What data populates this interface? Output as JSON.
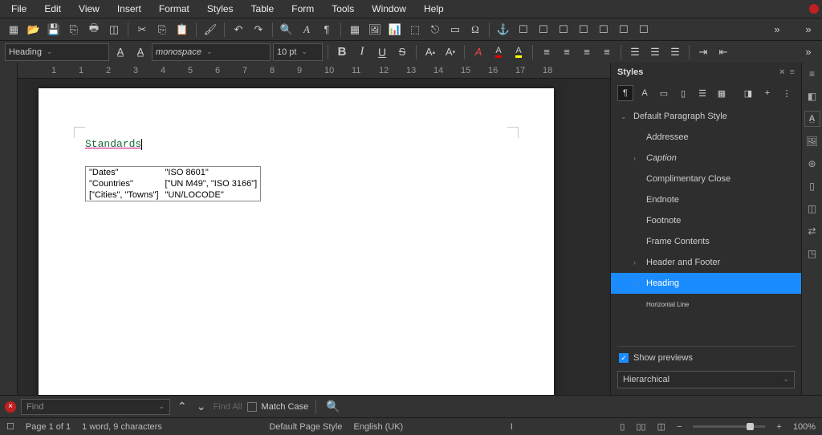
{
  "menubar": [
    "File",
    "Edit",
    "View",
    "Insert",
    "Format",
    "Styles",
    "Table",
    "Form",
    "Tools",
    "Window",
    "Help"
  ],
  "toolbar2": {
    "paragraph_style": "Heading",
    "font_name": "monospace",
    "font_size": "10 pt"
  },
  "document": {
    "heading": "Standards",
    "table": [
      [
        "\"Dates\"",
        "\"ISO 8601\""
      ],
      [
        "\"Countries\"",
        "[\"UN M49\", \"ISO 3166\"]"
      ],
      [
        "[\"Cities\", \"Towns\"]",
        "\"UN/LOCODE\""
      ]
    ]
  },
  "styles_panel": {
    "title": "Styles",
    "items": [
      {
        "label": "Default Paragraph Style",
        "depth": 0,
        "exp": "v"
      },
      {
        "label": "Addressee",
        "depth": 1,
        "exp": ""
      },
      {
        "label": "Caption",
        "depth": 1,
        "exp": ">",
        "italic": true
      },
      {
        "label": "Complimentary Close",
        "depth": 1,
        "exp": ""
      },
      {
        "label": "Endnote",
        "depth": 1,
        "exp": ""
      },
      {
        "label": "Footnote",
        "depth": 1,
        "exp": ""
      },
      {
        "label": "Frame Contents",
        "depth": 1,
        "exp": ""
      },
      {
        "label": "Header and Footer",
        "depth": 1,
        "exp": ">"
      },
      {
        "label": "Heading",
        "depth": 1,
        "exp": ">",
        "sel": true
      },
      {
        "label": "Horizontal Line",
        "depth": 1,
        "exp": "",
        "small": true
      }
    ],
    "show_previews": "Show previews",
    "filter": "Hierarchical"
  },
  "findbar": {
    "placeholder": "Find",
    "find_all": "Find All",
    "match_case": "Match Case"
  },
  "statusbar": {
    "page": "Page 1 of 1",
    "words": "1 word, 9 characters",
    "page_style": "Default Page Style",
    "lang": "English (UK)",
    "insert_mode": "I",
    "zoom": "100%"
  },
  "ruler_ticks": [
    -1,
    1,
    2,
    3,
    4,
    5,
    6,
    7,
    8,
    9,
    10,
    11,
    12,
    13,
    14,
    15,
    16,
    17,
    18
  ]
}
